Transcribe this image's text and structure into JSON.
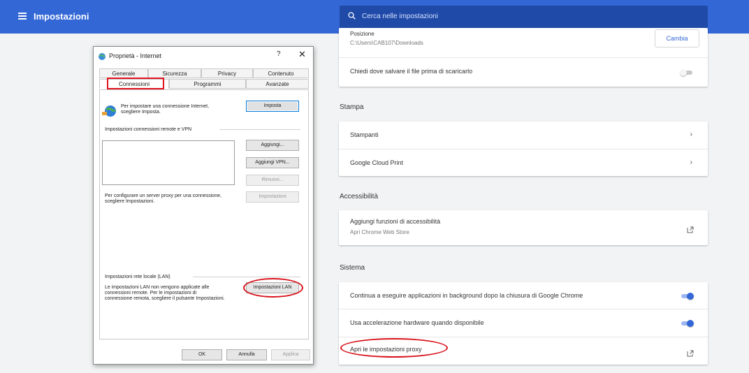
{
  "header": {
    "title": "Impostazioni",
    "search_placeholder": "Cerca nelle impostazioni"
  },
  "download": {
    "location_label": "Posizione",
    "location_path": "C:\\Users\\CAB107\\Downloads",
    "change_button": "Cambia",
    "ask_label": "Chiedi dove salvare il file prima di scaricarlo",
    "ask_toggle": false
  },
  "print": {
    "section_title": "Stampa",
    "items": [
      "Stampanti",
      "Google Cloud Print"
    ]
  },
  "accessibility": {
    "section_title": "Accessibilità",
    "item_label": "Aggiungi funzioni di accessibilità",
    "item_sub": "Apri Chrome Web Store"
  },
  "system": {
    "section_title": "Sistema",
    "background_label": "Continua a eseguire applicazioni in background dopo la chiusura di Google Chrome",
    "background_toggle": true,
    "hw_label": "Usa accelerazione hardware quando disponibile",
    "hw_toggle": true,
    "proxy_label": "Apri le impostazioni proxy"
  },
  "dialog": {
    "title": "Proprietà - Internet",
    "help": "?",
    "close": "✕",
    "tabs_row1": [
      "Generale",
      "Sicurezza",
      "Privacy",
      "Contenuto"
    ],
    "tabs_row2": [
      "Connessioni",
      "Programmi",
      "Avanzate"
    ],
    "setup_text": "Per impostare una connessione Internet, scegliere Imposta.",
    "setup_button": "Imposta",
    "dialup_group": "Impostazioni connessioni remote e VPN",
    "add_button": "Aggiungi...",
    "add_vpn_button": "Aggiungi VPN...",
    "remove_button": "Rimuovi...",
    "settings_button": "Impostazioni",
    "proxy_text": "Per configurare un server proxy per una connessione, scegliere Impostazioni.",
    "lan_group": "Impostazioni rete locale (LAN)",
    "lan_text": "Le impostazioni LAN non vengono applicate alle connessioni remote. Per le impostazioni di connessione remota, scegliere il pulsante Impostazioni.",
    "lan_button": "Impostazioni LAN",
    "ok": "OK",
    "cancel": "Annulla",
    "apply": "Applica"
  },
  "colors": {
    "header": "#3367d6",
    "accent": "#3367d6",
    "annotation": "#e0141e"
  }
}
